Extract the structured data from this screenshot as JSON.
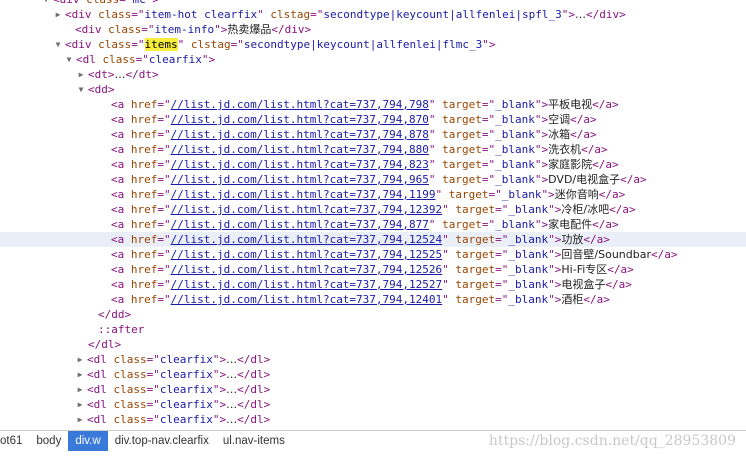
{
  "rows": [
    {
      "indent": 53,
      "twisty": "open",
      "segs": [
        [
          "tag",
          "<div "
        ],
        [
          "an",
          "class"
        ],
        [
          "tag",
          "=\""
        ],
        [
          "av",
          "mc"
        ],
        [
          "tag",
          "\">"
        ]
      ]
    },
    {
      "indent": 65,
      "twisty": "closed",
      "segs": [
        [
          "tag",
          "<div "
        ],
        [
          "an",
          "class"
        ],
        [
          "tag",
          "=\""
        ],
        [
          "av",
          "item-hot clearfix"
        ],
        [
          "tag",
          "\" "
        ],
        [
          "an",
          "clstag"
        ],
        [
          "tag",
          "=\""
        ],
        [
          "av",
          "secondtype|keycount|allfenlei|spfl_3"
        ],
        [
          "tag",
          "\">"
        ],
        [
          "tx",
          "…"
        ],
        [
          "tag",
          "</div>"
        ]
      ]
    },
    {
      "indent": 75,
      "segs": [
        [
          "tag",
          "<div "
        ],
        [
          "an",
          "class"
        ],
        [
          "tag",
          "=\""
        ],
        [
          "av",
          "item-info"
        ],
        [
          "tag",
          "\">"
        ],
        [
          "tx",
          "热卖爆品"
        ],
        [
          "tag",
          "</div>"
        ]
      ]
    },
    {
      "indent": 65,
      "twisty": "open",
      "segs": [
        [
          "tag",
          "<div "
        ],
        [
          "an",
          "class"
        ],
        [
          "tag",
          "=\""
        ],
        [
          "hl",
          "items"
        ],
        [
          "tag",
          "\" "
        ],
        [
          "an",
          "clstag"
        ],
        [
          "tag",
          "=\""
        ],
        [
          "av",
          "secondtype|keycount|allfenlei|flmc_3"
        ],
        [
          "tag",
          "\">"
        ]
      ]
    },
    {
      "indent": 76,
      "twisty": "open",
      "segs": [
        [
          "tag",
          "<dl "
        ],
        [
          "an",
          "class"
        ],
        [
          "tag",
          "=\""
        ],
        [
          "av",
          "clearfix"
        ],
        [
          "tag",
          "\">"
        ]
      ]
    },
    {
      "indent": 88,
      "twisty": "closed",
      "segs": [
        [
          "tag",
          "<dt>"
        ],
        [
          "tx",
          "…"
        ],
        [
          "tag",
          "</dt>"
        ]
      ]
    },
    {
      "indent": 88,
      "twisty": "open",
      "segs": [
        [
          "tag",
          "<dd>"
        ]
      ]
    },
    {
      "indent": 111,
      "segs": [
        [
          "tag",
          "<a "
        ],
        [
          "an",
          "href"
        ],
        [
          "tag",
          "=\""
        ],
        [
          "link",
          "//list.jd.com/list.html?cat=737,794,798"
        ],
        [
          "tag",
          "\" "
        ],
        [
          "an",
          "target"
        ],
        [
          "tag",
          "=\""
        ],
        [
          "av",
          "_blank"
        ],
        [
          "tag",
          "\">"
        ],
        [
          "tx",
          "平板电视"
        ],
        [
          "tag",
          "</a>"
        ]
      ]
    },
    {
      "indent": 111,
      "segs": [
        [
          "tag",
          "<a "
        ],
        [
          "an",
          "href"
        ],
        [
          "tag",
          "=\""
        ],
        [
          "link",
          "//list.jd.com/list.html?cat=737,794,870"
        ],
        [
          "tag",
          "\" "
        ],
        [
          "an",
          "target"
        ],
        [
          "tag",
          "=\""
        ],
        [
          "av",
          "_blank"
        ],
        [
          "tag",
          "\">"
        ],
        [
          "tx",
          "空调"
        ],
        [
          "tag",
          "</a>"
        ]
      ]
    },
    {
      "indent": 111,
      "segs": [
        [
          "tag",
          "<a "
        ],
        [
          "an",
          "href"
        ],
        [
          "tag",
          "=\""
        ],
        [
          "link",
          "//list.jd.com/list.html?cat=737,794,878"
        ],
        [
          "tag",
          "\" "
        ],
        [
          "an",
          "target"
        ],
        [
          "tag",
          "=\""
        ],
        [
          "av",
          "_blank"
        ],
        [
          "tag",
          "\">"
        ],
        [
          "tx",
          "冰箱"
        ],
        [
          "tag",
          "</a>"
        ]
      ]
    },
    {
      "indent": 111,
      "segs": [
        [
          "tag",
          "<a "
        ],
        [
          "an",
          "href"
        ],
        [
          "tag",
          "=\""
        ],
        [
          "link",
          "//list.jd.com/list.html?cat=737,794,880"
        ],
        [
          "tag",
          "\" "
        ],
        [
          "an",
          "target"
        ],
        [
          "tag",
          "=\""
        ],
        [
          "av",
          "_blank"
        ],
        [
          "tag",
          "\">"
        ],
        [
          "tx",
          "洗衣机"
        ],
        [
          "tag",
          "</a>"
        ]
      ]
    },
    {
      "indent": 111,
      "segs": [
        [
          "tag",
          "<a "
        ],
        [
          "an",
          "href"
        ],
        [
          "tag",
          "=\""
        ],
        [
          "link",
          "//list.jd.com/list.html?cat=737,794,823"
        ],
        [
          "tag",
          "\" "
        ],
        [
          "an",
          "target"
        ],
        [
          "tag",
          "=\""
        ],
        [
          "av",
          "_blank"
        ],
        [
          "tag",
          "\">"
        ],
        [
          "tx",
          "家庭影院"
        ],
        [
          "tag",
          "</a>"
        ]
      ]
    },
    {
      "indent": 111,
      "segs": [
        [
          "tag",
          "<a "
        ],
        [
          "an",
          "href"
        ],
        [
          "tag",
          "=\""
        ],
        [
          "link",
          "//list.jd.com/list.html?cat=737,794,965"
        ],
        [
          "tag",
          "\" "
        ],
        [
          "an",
          "target"
        ],
        [
          "tag",
          "=\""
        ],
        [
          "av",
          "_blank"
        ],
        [
          "tag",
          "\">"
        ],
        [
          "tx",
          "DVD/电视盒子"
        ],
        [
          "tag",
          "</a>"
        ]
      ]
    },
    {
      "indent": 111,
      "segs": [
        [
          "tag",
          "<a "
        ],
        [
          "an",
          "href"
        ],
        [
          "tag",
          "=\""
        ],
        [
          "link",
          "//list.jd.com/list.html?cat=737,794,1199"
        ],
        [
          "tag",
          "\" "
        ],
        [
          "an",
          "target"
        ],
        [
          "tag",
          "=\""
        ],
        [
          "av",
          "_blank"
        ],
        [
          "tag",
          "\">"
        ],
        [
          "tx",
          "迷你音响"
        ],
        [
          "tag",
          "</a>"
        ]
      ]
    },
    {
      "indent": 111,
      "segs": [
        [
          "tag",
          "<a "
        ],
        [
          "an",
          "href"
        ],
        [
          "tag",
          "=\""
        ],
        [
          "link",
          "//list.jd.com/list.html?cat=737,794,12392"
        ],
        [
          "tag",
          "\" "
        ],
        [
          "an",
          "target"
        ],
        [
          "tag",
          "=\""
        ],
        [
          "av",
          "_blank"
        ],
        [
          "tag",
          "\">"
        ],
        [
          "tx",
          "冷柜/冰吧"
        ],
        [
          "tag",
          "</a>"
        ]
      ]
    },
    {
      "indent": 111,
      "segs": [
        [
          "tag",
          "<a "
        ],
        [
          "an",
          "href"
        ],
        [
          "tag",
          "=\""
        ],
        [
          "link",
          "//list.jd.com/list.html?cat=737,794,877"
        ],
        [
          "tag",
          "\" "
        ],
        [
          "an",
          "target"
        ],
        [
          "tag",
          "=\""
        ],
        [
          "av",
          "_blank"
        ],
        [
          "tag",
          "\">"
        ],
        [
          "tx",
          "家电配件"
        ],
        [
          "tag",
          "</a>"
        ]
      ]
    },
    {
      "indent": 111,
      "selected": true,
      "segs": [
        [
          "tag",
          "<a "
        ],
        [
          "an",
          "href"
        ],
        [
          "tag",
          "=\""
        ],
        [
          "link",
          "//list.jd.com/list.html?cat=737,794,12524"
        ],
        [
          "tag",
          "\" "
        ],
        [
          "an",
          "target"
        ],
        [
          "tag",
          "=\""
        ],
        [
          "av",
          "_blank"
        ],
        [
          "tag",
          "\">"
        ],
        [
          "tx",
          "功放"
        ],
        [
          "tag",
          "</a>"
        ]
      ]
    },
    {
      "indent": 111,
      "segs": [
        [
          "tag",
          "<a "
        ],
        [
          "an",
          "href"
        ],
        [
          "tag",
          "=\""
        ],
        [
          "link",
          "//list.jd.com/list.html?cat=737,794,12525"
        ],
        [
          "tag",
          "\" "
        ],
        [
          "an",
          "target"
        ],
        [
          "tag",
          "=\""
        ],
        [
          "av",
          "_blank"
        ],
        [
          "tag",
          "\">"
        ],
        [
          "tx",
          "回音壁/Soundbar"
        ],
        [
          "tag",
          "</a>"
        ]
      ]
    },
    {
      "indent": 111,
      "segs": [
        [
          "tag",
          "<a "
        ],
        [
          "an",
          "href"
        ],
        [
          "tag",
          "=\""
        ],
        [
          "link",
          "//list.jd.com/list.html?cat=737,794,12526"
        ],
        [
          "tag",
          "\" "
        ],
        [
          "an",
          "target"
        ],
        [
          "tag",
          "=\""
        ],
        [
          "av",
          "_blank"
        ],
        [
          "tag",
          "\">"
        ],
        [
          "tx",
          "Hi-Fi专区"
        ],
        [
          "tag",
          "</a>"
        ]
      ]
    },
    {
      "indent": 111,
      "segs": [
        [
          "tag",
          "<a "
        ],
        [
          "an",
          "href"
        ],
        [
          "tag",
          "=\""
        ],
        [
          "link",
          "//list.jd.com/list.html?cat=737,794,12527"
        ],
        [
          "tag",
          "\" "
        ],
        [
          "an",
          "target"
        ],
        [
          "tag",
          "=\""
        ],
        [
          "av",
          "_blank"
        ],
        [
          "tag",
          "\">"
        ],
        [
          "tx",
          "电视盒子"
        ],
        [
          "tag",
          "</a>"
        ]
      ]
    },
    {
      "indent": 111,
      "segs": [
        [
          "tag",
          "<a "
        ],
        [
          "an",
          "href"
        ],
        [
          "tag",
          "=\""
        ],
        [
          "link",
          "//list.jd.com/list.html?cat=737,794,12401"
        ],
        [
          "tag",
          "\" "
        ],
        [
          "an",
          "target"
        ],
        [
          "tag",
          "=\""
        ],
        [
          "av",
          "_blank"
        ],
        [
          "tag",
          "\">"
        ],
        [
          "tx",
          "酒柜"
        ],
        [
          "tag",
          "</a>"
        ]
      ]
    },
    {
      "indent": 98,
      "segs": [
        [
          "tag",
          "</dd>"
        ]
      ]
    },
    {
      "indent": 98,
      "segs": [
        [
          "pseudo",
          "::after"
        ]
      ]
    },
    {
      "indent": 88,
      "segs": [
        [
          "tag",
          "</dl>"
        ]
      ]
    },
    {
      "indent": 87,
      "twisty": "closed",
      "segs": [
        [
          "tag",
          "<dl "
        ],
        [
          "an",
          "class"
        ],
        [
          "tag",
          "=\""
        ],
        [
          "av",
          "clearfix"
        ],
        [
          "tag",
          "\">"
        ],
        [
          "tx",
          "…"
        ],
        [
          "tag",
          "</dl>"
        ]
      ]
    },
    {
      "indent": 87,
      "twisty": "closed",
      "segs": [
        [
          "tag",
          "<dl "
        ],
        [
          "an",
          "class"
        ],
        [
          "tag",
          "=\""
        ],
        [
          "av",
          "clearfix"
        ],
        [
          "tag",
          "\">"
        ],
        [
          "tx",
          "…"
        ],
        [
          "tag",
          "</dl>"
        ]
      ]
    },
    {
      "indent": 87,
      "twisty": "closed",
      "segs": [
        [
          "tag",
          "<dl "
        ],
        [
          "an",
          "class"
        ],
        [
          "tag",
          "=\""
        ],
        [
          "av",
          "clearfix"
        ],
        [
          "tag",
          "\">"
        ],
        [
          "tx",
          "…"
        ],
        [
          "tag",
          "</dl>"
        ]
      ]
    },
    {
      "indent": 87,
      "twisty": "closed",
      "segs": [
        [
          "tag",
          "<dl "
        ],
        [
          "an",
          "class"
        ],
        [
          "tag",
          "=\""
        ],
        [
          "av",
          "clearfix"
        ],
        [
          "tag",
          "\">"
        ],
        [
          "tx",
          "…"
        ],
        [
          "tag",
          "</dl>"
        ]
      ]
    },
    {
      "indent": 87,
      "twisty": "closed",
      "segs": [
        [
          "tag",
          "<dl "
        ],
        [
          "an",
          "class"
        ],
        [
          "tag",
          "=\""
        ],
        [
          "av",
          "clearfix"
        ],
        [
          "tag",
          "\">"
        ],
        [
          "tx",
          "…"
        ],
        [
          "tag",
          "</dl>"
        ]
      ]
    }
  ],
  "breadcrumbs": [
    "ot61",
    "body",
    "div.w",
    "div.top-nav.clearfix",
    "ul.nav-items"
  ],
  "active_crumb": "div.w",
  "watermark": "https://blog.csdn.net/qq_28953809",
  "colors": {
    "tag": "#881280",
    "attr_name": "#994500",
    "attr_value": "#1a1aa6",
    "search_highlight": "#f7ee3e",
    "selected_row": "#e9eef7",
    "active_crumb": "#3879d9"
  }
}
